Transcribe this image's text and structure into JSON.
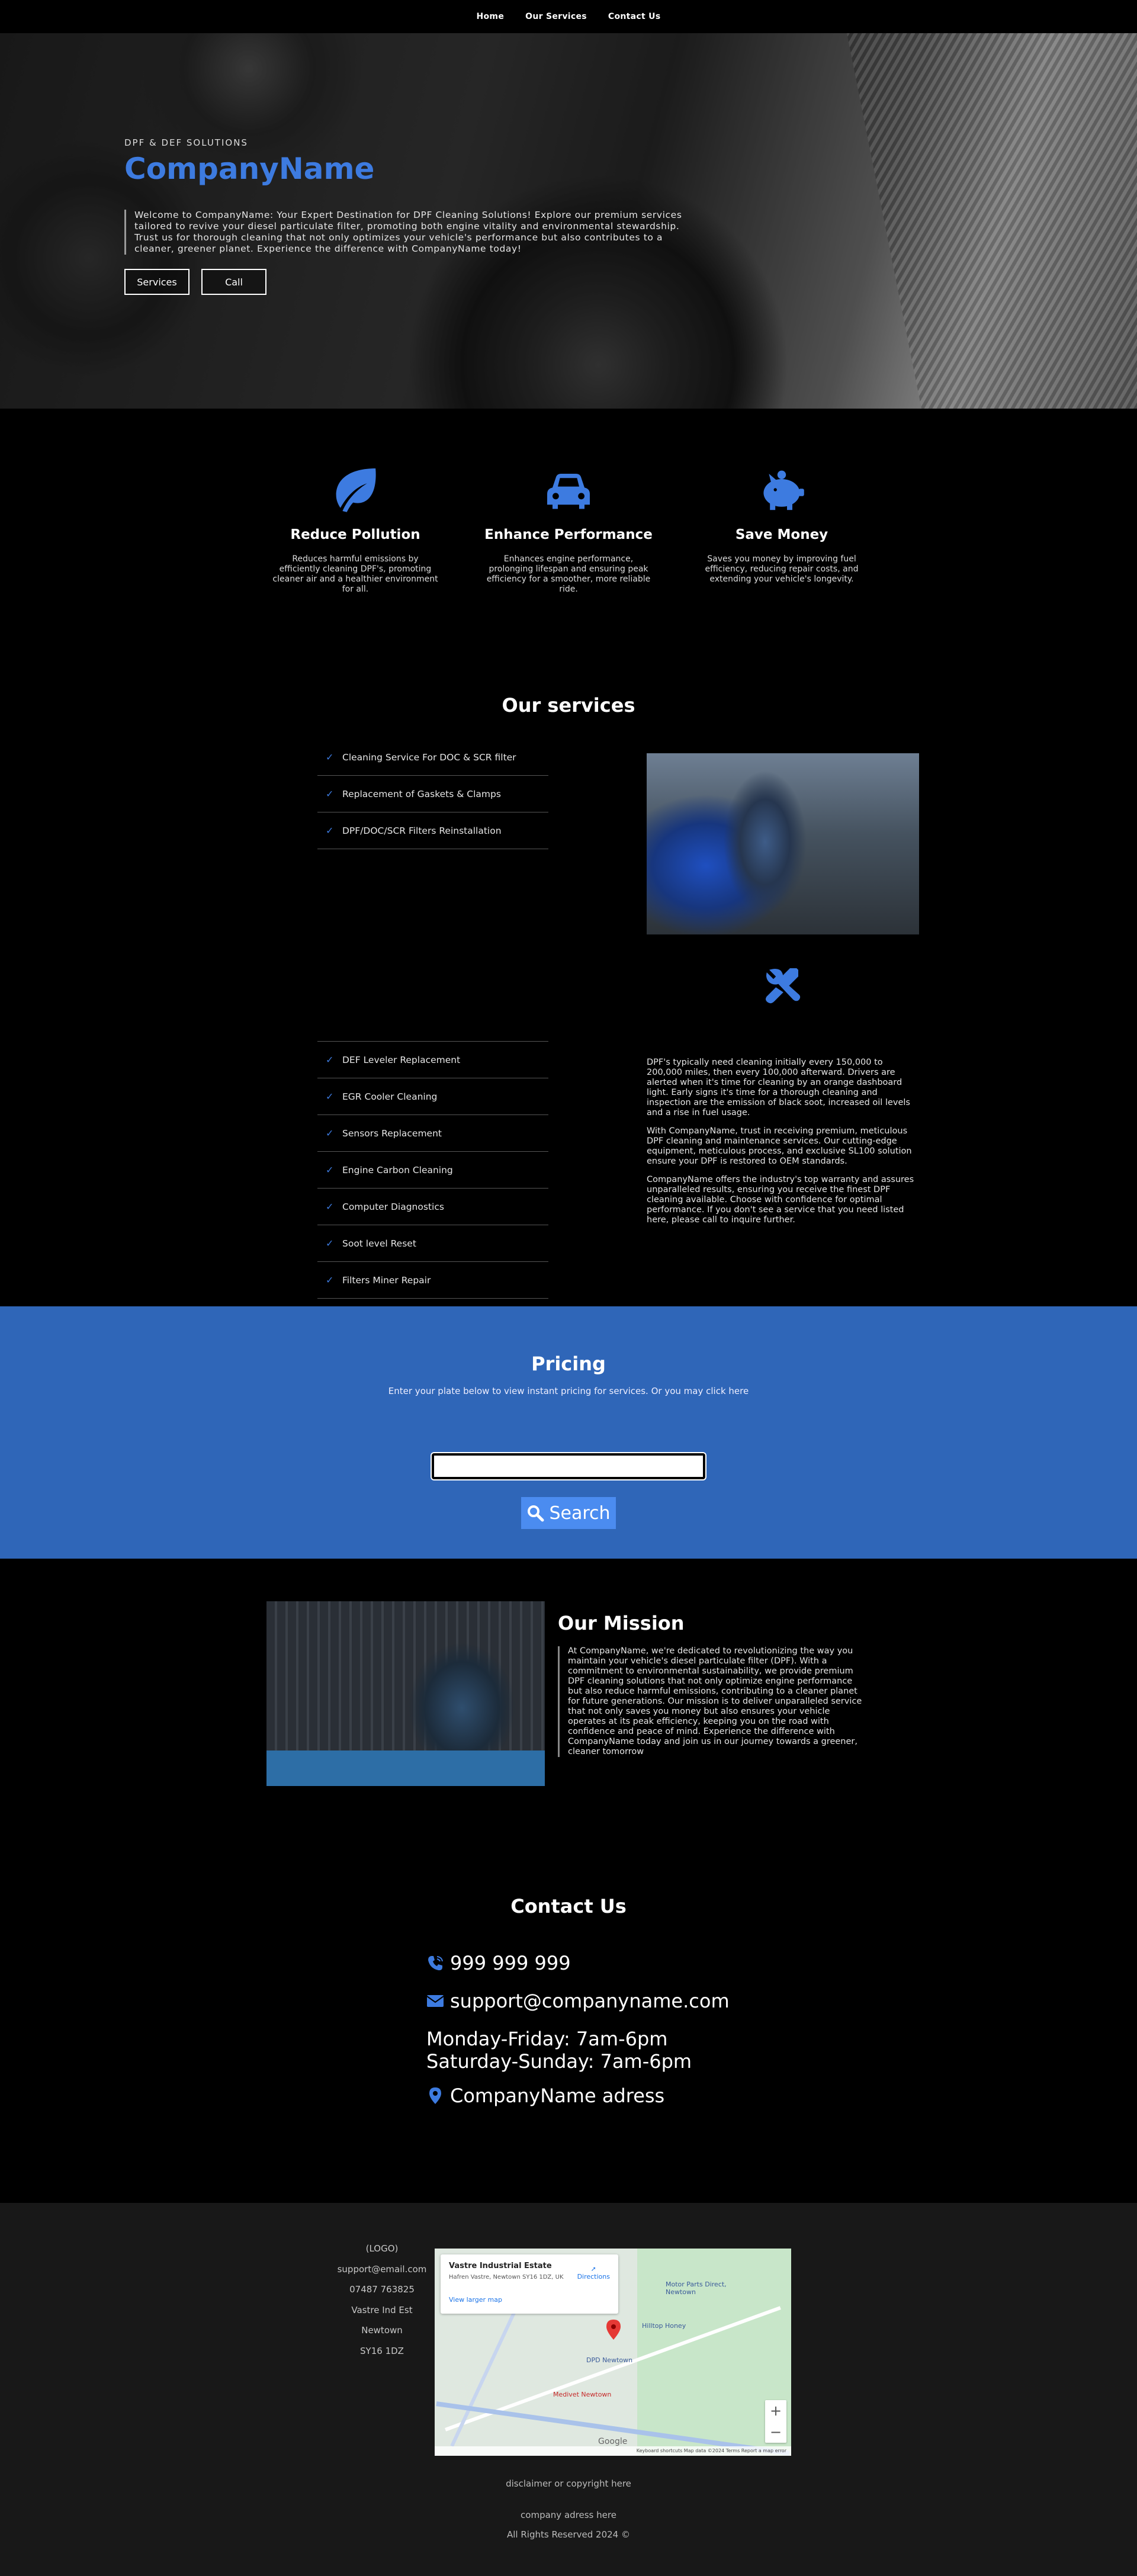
{
  "nav": {
    "items": [
      "Home",
      "Our Services",
      "Contact Us"
    ]
  },
  "hero": {
    "kicker": "DPF & DEF SOLUTIONS",
    "title": "CompanyName",
    "text": "Welcome to CompanyName: Your Expert Destination for DPF Cleaning Solutions! Explore our premium services tailored to revive your diesel particulate filter, promoting both engine vitality and environmental stewardship. Trust us for thorough cleaning that not only optimizes your vehicle's performance but also contributes to a cleaner, greener planet. Experience the difference with CompanyName today!",
    "btn_services": "Services",
    "btn_call": "Call"
  },
  "features": [
    {
      "icon": "leaf-icon",
      "title": "Reduce Pollution",
      "text": "Reduces harmful emissions by efficiently cleaning DPF's, promoting cleaner air and a healthier environment for all."
    },
    {
      "icon": "car-icon",
      "title": "Enhance Performance",
      "text": "Enhances engine performance, prolonging lifespan and ensuring peak efficiency for a smoother, more reliable ride."
    },
    {
      "icon": "piggy-bank-icon",
      "title": "Save Money",
      "text": "Saves you money by improving fuel efficiency, reducing repair costs, and extending your vehicle's longevity."
    }
  ],
  "services": {
    "title": "Our services",
    "top_items": [
      "Cleaning Service For DOC & SCR filter",
      "Replacement of Gaskets & Clamps",
      "DPF/DOC/SCR Filters Reinstallation"
    ],
    "bottom_items": [
      "DEF Leveler Replacement",
      "EGR Cooler Cleaning",
      "Sensors Replacement",
      "Engine Carbon Cleaning",
      "Computer Diagnostics",
      "Soot level Reset",
      "Filters Miner Repair"
    ],
    "paragraphs": [
      "DPF's typically need cleaning initially every 150,000 to 200,000 miles, then every 100,000 afterward. Drivers are alerted when it's time for cleaning by an orange dashboard light. Early signs it's time for a thorough cleaning and inspection are the emission of black soot, increased oil levels and a rise in fuel usage.",
      "With CompanyName, trust in receiving premium, meticulous DPF cleaning and maintenance services. Our cutting-edge equipment, meticulous process, and exclusive SL100 solution ensure your DPF is restored to OEM standards.",
      "CompanyName offers the industry's top warranty and assures unparalleled results, ensuring you receive the finest DPF cleaning available. Choose with confidence for optimal performance. If you don't see a service that you need listed here, please call to inquire further."
    ]
  },
  "pricing": {
    "title": "Pricing",
    "subtitle": "Enter your plate below to view instant pricing for services. Or you may click here",
    "search_label": "Search"
  },
  "mission": {
    "title": "Our Mission",
    "text": "At CompanyName, we're dedicated to revolutionizing the way you maintain your vehicle's diesel particulate filter (DPF). With a commitment to environmental sustainability, we provide premium DPF cleaning solutions that not only optimize engine performance but also reduce harmful emissions, contributing to a cleaner planet for future generations. Our mission is to deliver unparalleled service that not only saves you money but also ensures your vehicle operates at its peak efficiency, keeping you on the road with confidence and peace of mind. Experience the difference with CompanyName today and join us in our journey towards a greener, cleaner tomorrow"
  },
  "contact": {
    "title": "Contact Us",
    "phone": "999 999 999",
    "email": "support@companyname.com",
    "hours1": "Monday-Friday: 7am-6pm",
    "hours2": "Saturday-Sunday: 7am-6pm",
    "address": "CompanyName adress"
  },
  "footer": {
    "lines": [
      "(LOGO)",
      "support@email.com",
      "07487 763825",
      "Vastre Ind Est",
      "Newtown",
      "SY16 1DZ"
    ],
    "map": {
      "place": "Vastre Industrial Estate",
      "address": "Hafren Vastre, Newtown SY16 1DZ, UK",
      "directions": "Directions",
      "larger": "View larger map",
      "labels": [
        "Motor Parts Direct, Newtown",
        "Hilltop Honey",
        "DPD Newtown",
        "Medivet Newtown",
        "Google"
      ],
      "attribution": "Keyboard shortcuts   Map data ©2024   Terms   Report a map error"
    },
    "disclaimer": "disclaimer or copyright here",
    "company_address": "company adress here",
    "rights": "All Rights Reserved 2024 ©"
  },
  "colors": {
    "accent": "#3d7be0",
    "pricing_bg": "#2f66b8",
    "footer_bg": "#181818"
  }
}
